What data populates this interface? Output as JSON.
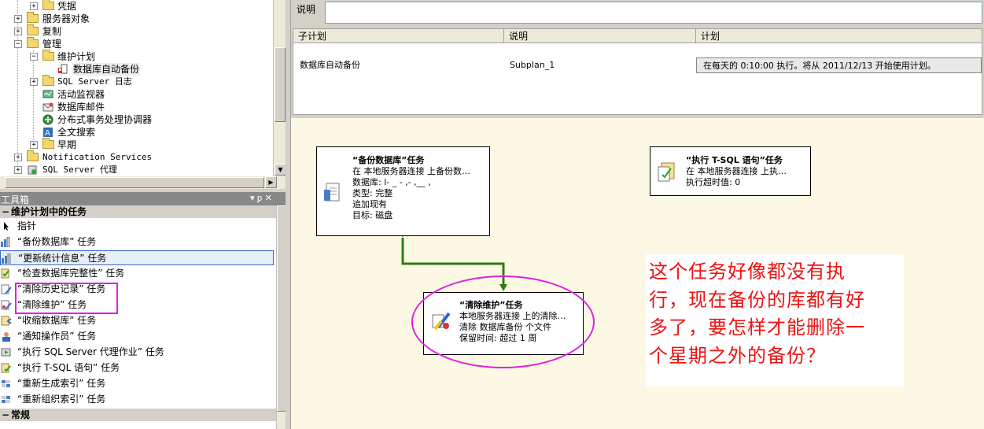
{
  "tree": {
    "items": [
      {
        "label": "凭据"
      },
      {
        "label": "服务器对象"
      },
      {
        "label": "复制"
      },
      {
        "label": "管理"
      },
      {
        "label": "维护计划"
      },
      {
        "label": "数据库自动备份"
      },
      {
        "label": "SQL Server 日志"
      },
      {
        "label": "活动监视器"
      },
      {
        "label": "数据库邮件"
      },
      {
        "label": "分布式事务处理协调器"
      },
      {
        "label": "全文搜索"
      },
      {
        "label": "早期"
      },
      {
        "label": "Notification Services"
      },
      {
        "label": "SQL Server 代理"
      }
    ]
  },
  "toolbox": {
    "title": "工具箱",
    "pin_glyph": "▾ ᵱ ✕",
    "section_title": "维护计划中的任务",
    "items": [
      {
        "label": "指针"
      },
      {
        "label": "“备份数据库” 任务"
      },
      {
        "label": "“更新统计信息” 任务"
      },
      {
        "label": "“检查数据库完整性” 任务"
      },
      {
        "label": "“清除历史记录” 任务"
      },
      {
        "label": "“清除维护” 任务"
      },
      {
        "label": "“收缩数据库” 任务"
      },
      {
        "label": "“通知操作员” 任务"
      },
      {
        "label": "“执行 SQL Server 代理作业” 任务"
      },
      {
        "label": "“执行 T-SQL 语句” 任务"
      },
      {
        "label": "“重新生成索引” 任务"
      },
      {
        "label": "“重新组织索引” 任务"
      }
    ],
    "footer_section": "常规",
    "highlight_color": "#e020e0"
  },
  "description": {
    "label": "说明",
    "value": ""
  },
  "subplan_grid": {
    "headers": [
      "子计划",
      "说明",
      "计划"
    ],
    "rows": [
      {
        "subplan": "数据库自动备份",
        "desc": "Subplan_1",
        "schedule": "在每天的 0:10:00 执行。将从 2011/12/13 开始使用计划。"
      }
    ]
  },
  "tasks": {
    "backup": {
      "title": "“备份数据库”任务",
      "lines": [
        "在 本地服务器连接 上备份数…",
        "数据库: l- _ - ,- ,__ ,",
        "类型: 完整",
        "追加现有",
        "目标: 磁盘"
      ]
    },
    "tsql": {
      "title": "“执行 T-SQL 语句”任务",
      "lines": [
        "在 本地服务器连接 上执…",
        "执行超时值: 0"
      ]
    },
    "cleanup": {
      "title": "“清除维护”任务",
      "lines": [
        "本地服务器连接 上的清除…",
        "清除 数据库备份 个文件",
        "保留时间: 超过 1 周"
      ]
    }
  },
  "note": {
    "lines": [
      "这个任务好像都没有执",
      "行，现在备份的库都有好",
      "多了，要怎样才能删除一",
      "个星期之外的备份？"
    ],
    "color": "#ee1111"
  },
  "connector_color": "#2e7d12",
  "annotation_color": "#e020e0"
}
